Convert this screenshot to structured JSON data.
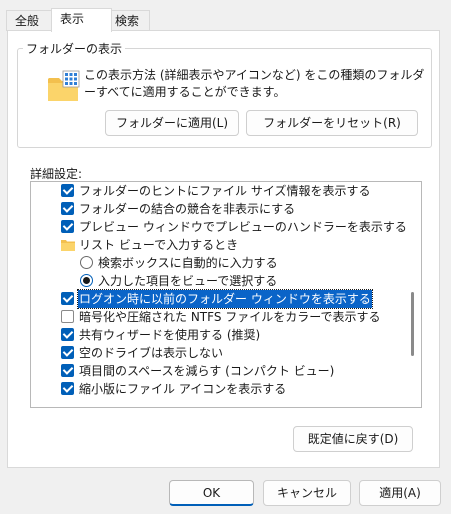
{
  "tabs": [
    {
      "label": "全般",
      "active": false
    },
    {
      "label": "表示",
      "active": true
    },
    {
      "label": "検索",
      "active": false
    }
  ],
  "folder_view": {
    "title": "フォルダーの表示",
    "description": "この表示方法 (詳細表示やアイコンなど) をこの種類のフォルダーすべてに適用することができます。",
    "apply_button": "フォルダーに適用(L)",
    "reset_button": "フォルダーをリセット(R)"
  },
  "advanced": {
    "label": "詳細設定:",
    "items": [
      {
        "type": "checkbox",
        "checked": true,
        "label": "フォルダーのヒントにファイル サイズ情報を表示する"
      },
      {
        "type": "checkbox",
        "checked": true,
        "label": "フォルダーの結合の競合を非表示にする"
      },
      {
        "type": "checkbox",
        "checked": true,
        "label": "プレビュー ウィンドウでプレビューのハンドラーを表示する"
      },
      {
        "type": "folder",
        "label": "リスト ビューで入力するとき"
      },
      {
        "type": "radio",
        "checked": false,
        "label": "検索ボックスに自動的に入力する"
      },
      {
        "type": "radio",
        "checked": true,
        "label": "入力した項目をビューで選択する"
      },
      {
        "type": "checkbox",
        "checked": true,
        "selected": true,
        "label": "ログオン時に以前のフォルダー ウィンドウを表示する"
      },
      {
        "type": "checkbox",
        "checked": false,
        "label": "暗号化や圧縮された NTFS ファイルをカラーで表示する"
      },
      {
        "type": "checkbox",
        "checked": true,
        "label": "共有ウィザードを使用する (推奨)"
      },
      {
        "type": "checkbox",
        "checked": true,
        "label": "空のドライブは表示しない"
      },
      {
        "type": "checkbox",
        "checked": true,
        "label": "項目間のスペースを減らす (コンパクト ビュー)"
      },
      {
        "type": "checkbox",
        "checked": true,
        "label": "縮小版にファイル アイコンを表示する"
      }
    ],
    "restore_button": "既定値に戻す(D)"
  },
  "footer": {
    "ok": "OK",
    "cancel": "キャンセル",
    "apply": "適用(A)"
  }
}
